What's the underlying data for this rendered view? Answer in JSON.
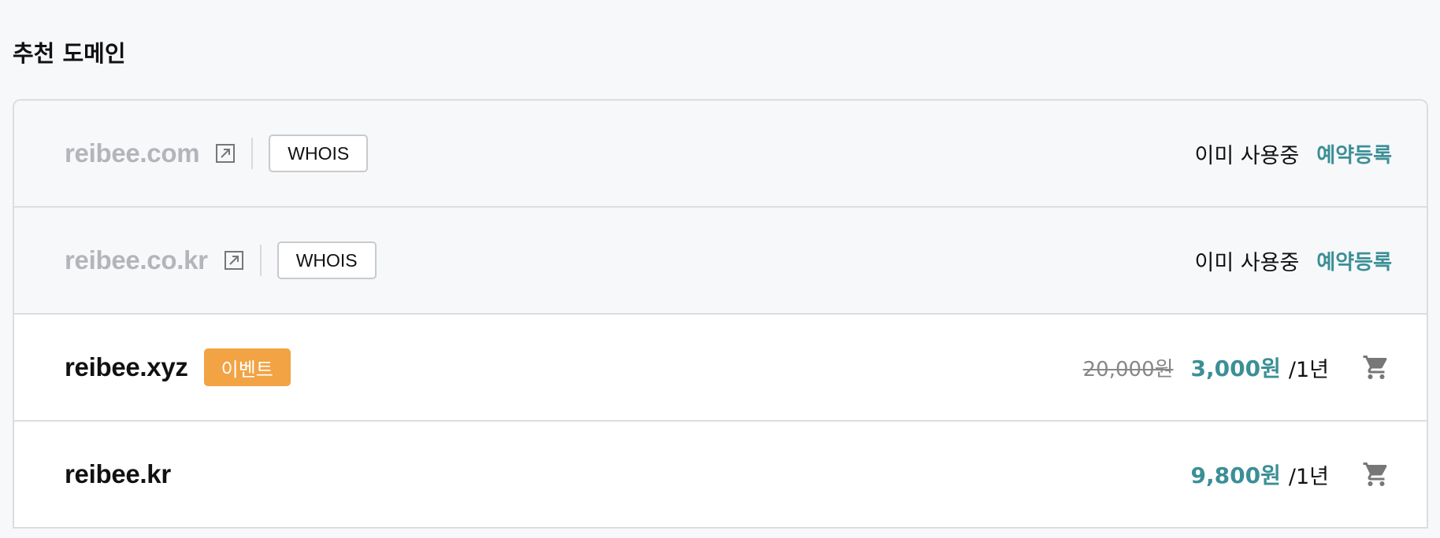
{
  "section": {
    "title": "추천 도메인"
  },
  "rows": [
    {
      "domain": "reibee.com",
      "status": "taken",
      "whois_label": "WHOIS",
      "status_text": "이미 사용중",
      "reserve_label": "예약등록",
      "icon": "external-link-icon"
    },
    {
      "domain": "reibee.co.kr",
      "status": "taken",
      "whois_label": "WHOIS",
      "status_text": "이미 사용중",
      "reserve_label": "예약등록",
      "icon": "external-link-icon"
    },
    {
      "domain": "reibee.xyz",
      "status": "available",
      "badge": "이벤트",
      "old_price": "20,000원",
      "price": "3,000원",
      "period": "/1년",
      "icon": "cart-icon"
    },
    {
      "domain": "reibee.kr",
      "status": "available",
      "price": "9,800원",
      "period": "/1년",
      "icon": "cart-icon"
    }
  ],
  "colors": {
    "accent": "#3b8f96",
    "badge": "#f2a344",
    "taken_domain": "#b3b5ba",
    "border": "#dcdde0"
  }
}
